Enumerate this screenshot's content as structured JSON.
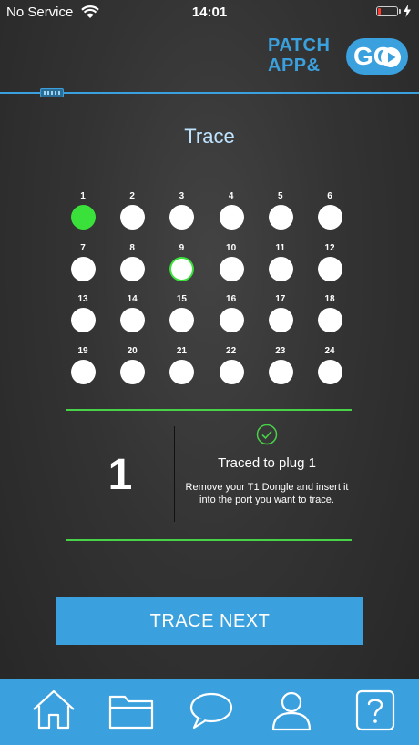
{
  "status_bar": {
    "carrier": "No Service",
    "time": "14:01"
  },
  "logo": {
    "line1": "PATCH",
    "line2": "APP&",
    "go": "GO"
  },
  "title": "Trace",
  "ports": [
    {
      "label": "1",
      "state": "active"
    },
    {
      "label": "2",
      "state": "idle"
    },
    {
      "label": "3",
      "state": "idle"
    },
    {
      "label": "4",
      "state": "idle"
    },
    {
      "label": "5",
      "state": "idle"
    },
    {
      "label": "6",
      "state": "idle"
    },
    {
      "label": "7",
      "state": "idle"
    },
    {
      "label": "8",
      "state": "idle"
    },
    {
      "label": "9",
      "state": "highlighted"
    },
    {
      "label": "10",
      "state": "idle"
    },
    {
      "label": "11",
      "state": "idle"
    },
    {
      "label": "12",
      "state": "idle"
    },
    {
      "label": "13",
      "state": "idle"
    },
    {
      "label": "14",
      "state": "idle"
    },
    {
      "label": "15",
      "state": "idle"
    },
    {
      "label": "16",
      "state": "idle"
    },
    {
      "label": "17",
      "state": "idle"
    },
    {
      "label": "18",
      "state": "idle"
    },
    {
      "label": "19",
      "state": "idle"
    },
    {
      "label": "20",
      "state": "idle"
    },
    {
      "label": "21",
      "state": "idle"
    },
    {
      "label": "22",
      "state": "idle"
    },
    {
      "label": "23",
      "state": "idle"
    },
    {
      "label": "24",
      "state": "idle"
    }
  ],
  "result": {
    "number": "1",
    "status": "Traced to plug 1",
    "instruction": "Remove your T1 Dongle and insert it into the port you want to trace."
  },
  "actions": {
    "trace_next": "TRACE NEXT"
  },
  "tabs": [
    {
      "name": "home",
      "icon": "home-icon"
    },
    {
      "name": "folder",
      "icon": "folder-icon"
    },
    {
      "name": "chat",
      "icon": "chat-bubble-icon"
    },
    {
      "name": "profile",
      "icon": "user-icon"
    },
    {
      "name": "help",
      "icon": "help-icon"
    }
  ],
  "colors": {
    "accent": "#3aa0de",
    "active_port": "#3be13b",
    "divider_green": "#47d247",
    "title": "#bfe4ff",
    "battery_low": "#ff3b30"
  }
}
